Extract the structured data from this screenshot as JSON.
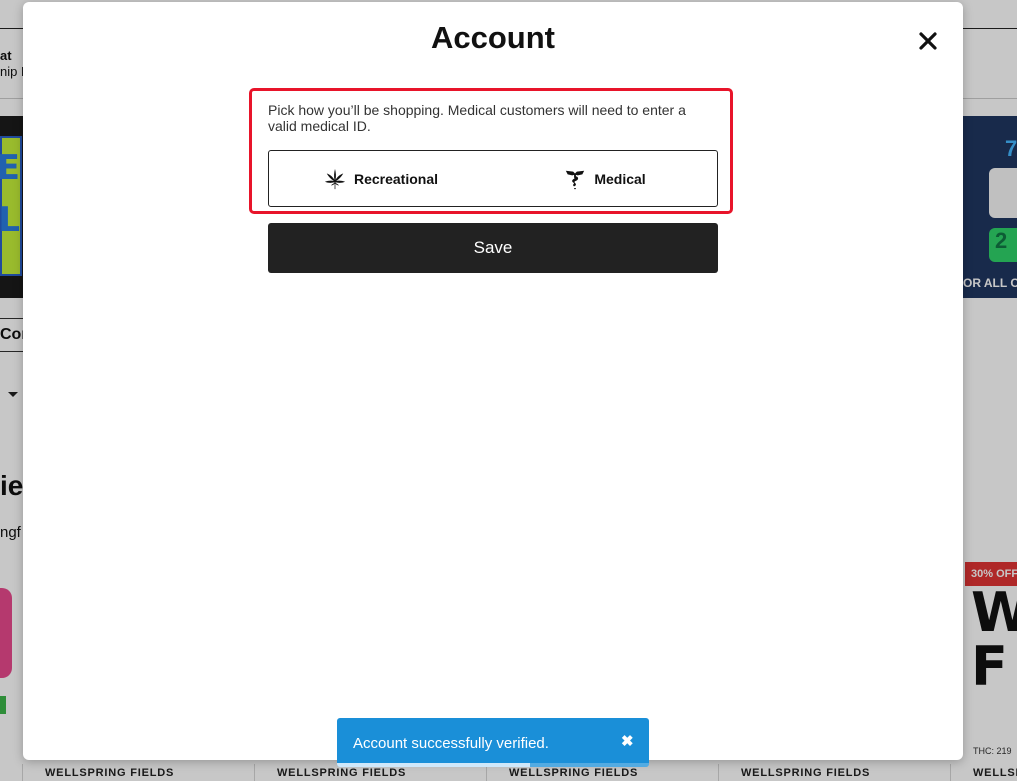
{
  "background": {
    "header_fragment": "at",
    "header_sub_fragment": "nip D",
    "tab_fragment": "Con",
    "heading_fragment": "ie",
    "subheading_fragment": "ngf",
    "banner_left_text": "E\nAL",
    "banner_right_num": "7",
    "banner_right_green": "2",
    "banner_right_caption": "OR ALL C",
    "sale_badge": "30% OFF",
    "product_logo_text": "We\nF",
    "thc_fragment": "THC: 219",
    "brand_labels": [
      "WELLSPRING FIELDS",
      "WELLSPRING FIELDS",
      "WELLSPRING FIELDS",
      "WELLSPRING FIELDS",
      "WELLSPRING"
    ]
  },
  "modal": {
    "title": "Account",
    "close_label": "✕",
    "instruction": "Pick how you’ll be shopping. Medical customers will need to enter a valid medical ID.",
    "options": [
      {
        "label": "Recreational",
        "icon": "cannabis-leaf-icon"
      },
      {
        "label": "Medical",
        "icon": "caduceus-icon"
      }
    ],
    "save_label": "Save",
    "highlight_color": "#e8142a"
  },
  "toast": {
    "message": "Account successfully verified.",
    "close_label": "✖",
    "progress": 0.62,
    "color": "#1a8fd8"
  }
}
